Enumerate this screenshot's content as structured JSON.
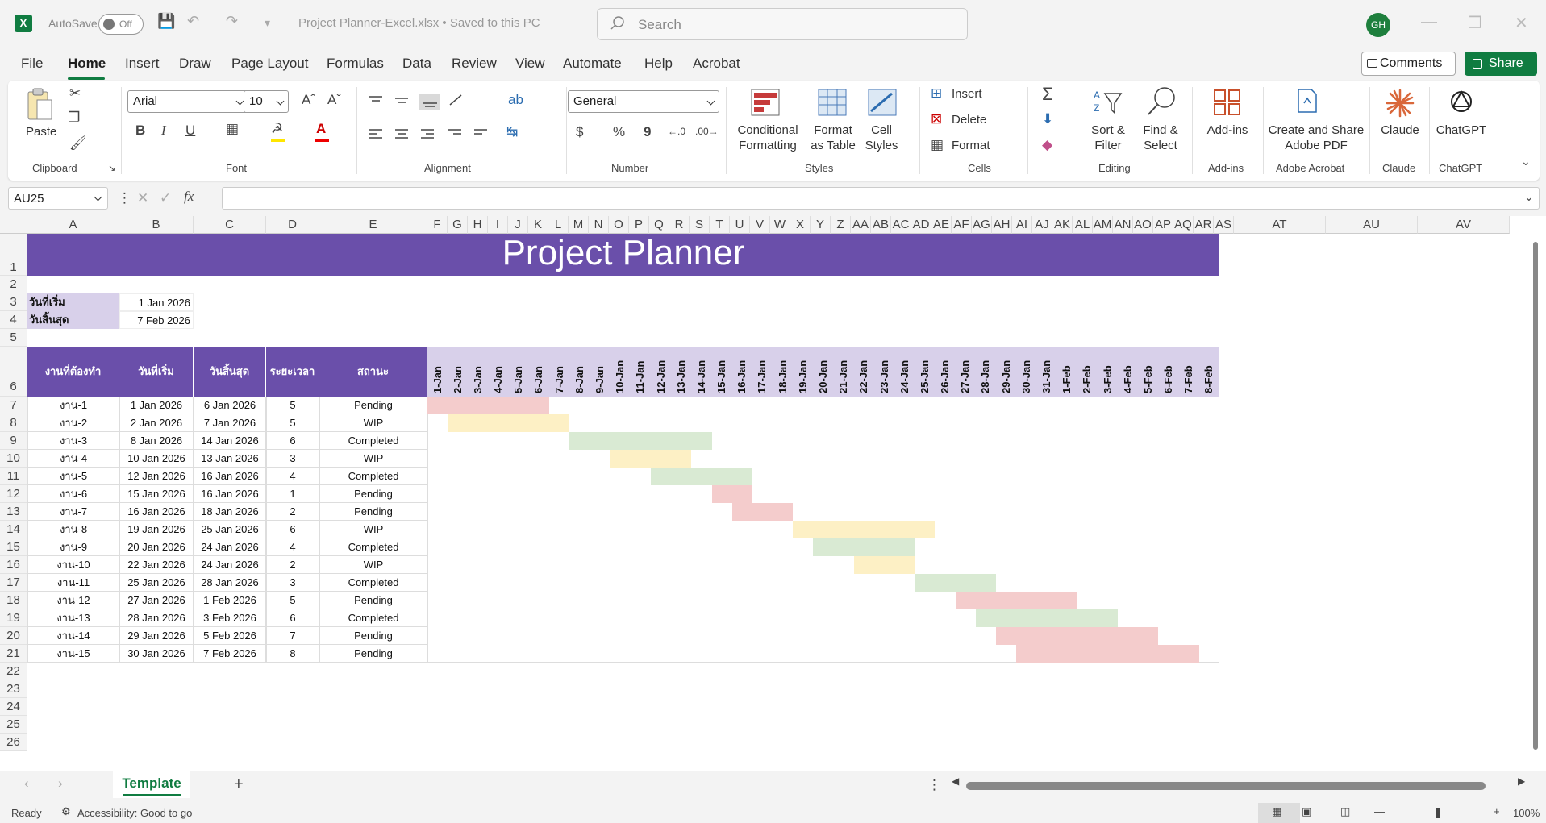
{
  "titlebar": {
    "autosave_label": "AutoSave",
    "autosave_state": "Off",
    "doc_title": "Project Planner-Excel.xlsx • Saved to this PC",
    "search_placeholder": "Search",
    "user_initials": "GH"
  },
  "menu": {
    "tabs": [
      "File",
      "Home",
      "Insert",
      "Draw",
      "Page Layout",
      "Formulas",
      "Data",
      "Review",
      "View",
      "Automate",
      "Help",
      "Acrobat"
    ],
    "active": "Home",
    "comments": "Comments",
    "share": "Share"
  },
  "ribbon": {
    "clipboard": {
      "paste": "Paste",
      "label": "Clipboard"
    },
    "font": {
      "name": "Arial",
      "size": "10",
      "bold": "B",
      "italic": "I",
      "underline": "U",
      "label": "Font"
    },
    "alignment": {
      "label": "Alignment"
    },
    "number": {
      "format": "General",
      "currency": "$",
      "percent": "%",
      "comma": "9",
      "label": "Number"
    },
    "styles": {
      "conditional": "Conditional Formatting",
      "format_table": "Format as Table",
      "cell_styles": "Cell Styles",
      "label": "Styles"
    },
    "cells": {
      "insert": "Insert",
      "delete": "Delete",
      "format": "Format",
      "label": "Cells"
    },
    "editing": {
      "sort": "Sort & Filter",
      "find": "Find & Select",
      "label": "Editing"
    },
    "addins": {
      "btn": "Add-ins",
      "label": "Add-ins"
    },
    "acrobat": {
      "btn": "Create and Share Adobe PDF",
      "label": "Adobe Acrobat"
    },
    "claude": {
      "btn": "Claude",
      "label": "Claude"
    },
    "chatgpt": {
      "btn": "ChatGPT",
      "label": "ChatGPT"
    }
  },
  "formula_bar": {
    "name_box": "AU25",
    "fx": "fx",
    "formula": ""
  },
  "columns": [
    "A",
    "B",
    "C",
    "D",
    "E",
    "F",
    "G",
    "H",
    "I",
    "J",
    "K",
    "L",
    "M",
    "N",
    "O",
    "P",
    "Q",
    "R",
    "S",
    "T",
    "U",
    "V",
    "W",
    "X",
    "Y",
    "Z",
    "AA",
    "AB",
    "AC",
    "AD",
    "AE",
    "AF",
    "AG",
    "AH",
    "AI",
    "AJ",
    "AK",
    "AL",
    "AM",
    "AN",
    "AO",
    "AP",
    "AQ",
    "AR",
    "AS",
    "AT",
    "AU",
    "AV"
  ],
  "rows": [
    "1",
    "2",
    "3",
    "4",
    "5",
    "6",
    "7",
    "8",
    "9",
    "10",
    "11",
    "12",
    "13",
    "14",
    "15",
    "16",
    "17",
    "18",
    "19",
    "20",
    "21",
    "22",
    "23",
    "24",
    "25",
    "26"
  ],
  "sheet": {
    "title": "Project Planner",
    "start_label": "วันที่เริ่ม",
    "start_value": "1 Jan 2026",
    "end_label": "วันสิ้นสุด",
    "end_value": "7 Feb 2026",
    "headers": [
      "งานที่ต้องทำ",
      "วันที่เริ่ม",
      "วันสิ้นสุด",
      "ระยะเวลา",
      "สถานะ"
    ],
    "dates": [
      "1-Jan",
      "2-Jan",
      "3-Jan",
      "4-Jan",
      "5-Jan",
      "6-Jan",
      "7-Jan",
      "8-Jan",
      "9-Jan",
      "10-Jan",
      "11-Jan",
      "12-Jan",
      "13-Jan",
      "14-Jan",
      "15-Jan",
      "16-Jan",
      "17-Jan",
      "18-Jan",
      "19-Jan",
      "20-Jan",
      "21-Jan",
      "22-Jan",
      "23-Jan",
      "24-Jan",
      "25-Jan",
      "26-Jan",
      "27-Jan",
      "28-Jan",
      "29-Jan",
      "30-Jan",
      "31-Jan",
      "1-Feb",
      "2-Feb",
      "3-Feb",
      "4-Feb",
      "5-Feb",
      "6-Feb",
      "7-Feb",
      "8-Feb"
    ],
    "tasks": [
      {
        "name": "งาน-1",
        "start": "1 Jan 2026",
        "end": "6 Jan 2026",
        "duration": "5",
        "status": "Pending",
        "s": 1,
        "e": 6
      },
      {
        "name": "งาน-2",
        "start": "2 Jan 2026",
        "end": "7 Jan 2026",
        "duration": "5",
        "status": "WIP",
        "s": 2,
        "e": 7
      },
      {
        "name": "งาน-3",
        "start": "8 Jan 2026",
        "end": "14 Jan 2026",
        "duration": "6",
        "status": "Completed",
        "s": 8,
        "e": 14
      },
      {
        "name": "งาน-4",
        "start": "10 Jan 2026",
        "end": "13 Jan 2026",
        "duration": "3",
        "status": "WIP",
        "s": 10,
        "e": 13
      },
      {
        "name": "งาน-5",
        "start": "12 Jan 2026",
        "end": "16 Jan 2026",
        "duration": "4",
        "status": "Completed",
        "s": 12,
        "e": 16
      },
      {
        "name": "งาน-6",
        "start": "15 Jan 2026",
        "end": "16 Jan 2026",
        "duration": "1",
        "status": "Pending",
        "s": 15,
        "e": 16
      },
      {
        "name": "งาน-7",
        "start": "16 Jan 2026",
        "end": "18 Jan 2026",
        "duration": "2",
        "status": "Pending",
        "s": 16,
        "e": 18
      },
      {
        "name": "งาน-8",
        "start": "19 Jan 2026",
        "end": "25 Jan 2026",
        "duration": "6",
        "status": "WIP",
        "s": 19,
        "e": 25
      },
      {
        "name": "งาน-9",
        "start": "20 Jan 2026",
        "end": "24 Jan 2026",
        "duration": "4",
        "status": "Completed",
        "s": 20,
        "e": 24
      },
      {
        "name": "งาน-10",
        "start": "22 Jan 2026",
        "end": "24 Jan 2026",
        "duration": "2",
        "status": "WIP",
        "s": 22,
        "e": 24
      },
      {
        "name": "งาน-11",
        "start": "25 Jan 2026",
        "end": "28 Jan 2026",
        "duration": "3",
        "status": "Completed",
        "s": 25,
        "e": 28
      },
      {
        "name": "งาน-12",
        "start": "27 Jan 2026",
        "end": "1 Feb 2026",
        "duration": "5",
        "status": "Pending",
        "s": 27,
        "e": 32
      },
      {
        "name": "งาน-13",
        "start": "28 Jan 2026",
        "end": "3 Feb 2026",
        "duration": "6",
        "status": "Completed",
        "s": 28,
        "e": 34
      },
      {
        "name": "งาน-14",
        "start": "29 Jan 2026",
        "end": "5 Feb 2026",
        "duration": "7",
        "status": "Pending",
        "s": 29,
        "e": 36
      },
      {
        "name": "งาน-15",
        "start": "30 Jan 2026",
        "end": "7 Feb 2026",
        "duration": "8",
        "status": "Pending",
        "s": 30,
        "e": 38
      }
    ],
    "status_colors": {
      "Pending": "#f4cccc",
      "WIP": "#fdf0c5",
      "Completed": "#d9ead3"
    },
    "accent": "#6a4faa"
  },
  "sheet_tabs": {
    "active": "Template"
  },
  "status": {
    "ready": "Ready",
    "accessibility": "Accessibility: Good to go",
    "zoom": "100%"
  }
}
